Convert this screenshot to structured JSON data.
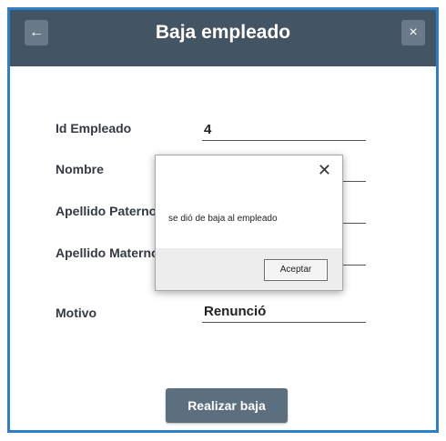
{
  "header": {
    "title": "Baja empleado",
    "back_glyph": "←",
    "close_glyph": "×"
  },
  "form": {
    "fields": [
      {
        "label": "Id Empleado",
        "value": "4"
      },
      {
        "label": "Nombre",
        "value": ""
      },
      {
        "label": "Apellido Paterno",
        "value": ""
      },
      {
        "label": "Apellido Materno",
        "value": ""
      },
      {
        "label": "Motivo",
        "value": "Renunció"
      }
    ],
    "submit_label": "Realizar baja"
  },
  "dialog": {
    "close_glyph": "✕",
    "message": "se dió de baja al empleado",
    "ok_label": "Aceptar"
  },
  "colors": {
    "header_bg": "#435463",
    "window_border": "#2f7fc8",
    "submit_bg": "#5c6f7e"
  },
  "icons": {
    "back": "arrow-left-icon",
    "close": "close-icon",
    "dialog_close": "close-icon"
  }
}
